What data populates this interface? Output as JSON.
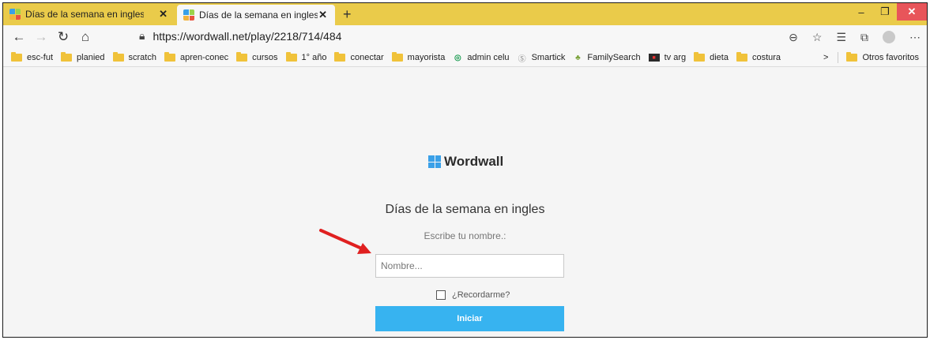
{
  "browser": {
    "tabs": [
      {
        "title": "Días de la semana en ingles - Un",
        "active": false
      },
      {
        "title": "Días de la semana en ingles - Re",
        "active": true
      }
    ],
    "new_tab": "+",
    "window_controls": {
      "minimize": "–",
      "maximize": "❐",
      "close": "✕"
    },
    "url": "https://wordwall.net/play/2218/714/484",
    "bookmarks": [
      {
        "label": "esc-fut",
        "icon": "folder-icon"
      },
      {
        "label": "planied",
        "icon": "folder-icon"
      },
      {
        "label": "scratch",
        "icon": "folder-icon"
      },
      {
        "label": "apren-conec",
        "icon": "folder-icon"
      },
      {
        "label": "cursos",
        "icon": "folder-icon"
      },
      {
        "label": "1° año",
        "icon": "folder-icon"
      },
      {
        "label": "conectar",
        "icon": "folder-icon"
      },
      {
        "label": "mayorista",
        "icon": "folder-icon"
      },
      {
        "label": "admin celu",
        "icon": "green-circle-icon"
      },
      {
        "label": "Smartick",
        "icon": "smartick-icon"
      },
      {
        "label": "FamilySearch",
        "icon": "tree-icon"
      },
      {
        "label": "tv arg",
        "icon": "tv-icon"
      },
      {
        "label": "dieta",
        "icon": "folder-icon"
      },
      {
        "label": "costura",
        "icon": "folder-icon"
      }
    ],
    "other_favorites": "Otros favoritos",
    "overflow_glyph": ">"
  },
  "page": {
    "logo_text": "Wordwall",
    "activity_title": "Días de la semana en ingles",
    "prompt": "Escribe tu nombre.:",
    "name_placeholder": "Nombre...",
    "remember_label": "¿Recordarme?",
    "start_label": "Iniciar"
  },
  "colors": {
    "tabbar": "#eacb4a",
    "start_button": "#37b3f0",
    "arrow": "#e02020"
  }
}
